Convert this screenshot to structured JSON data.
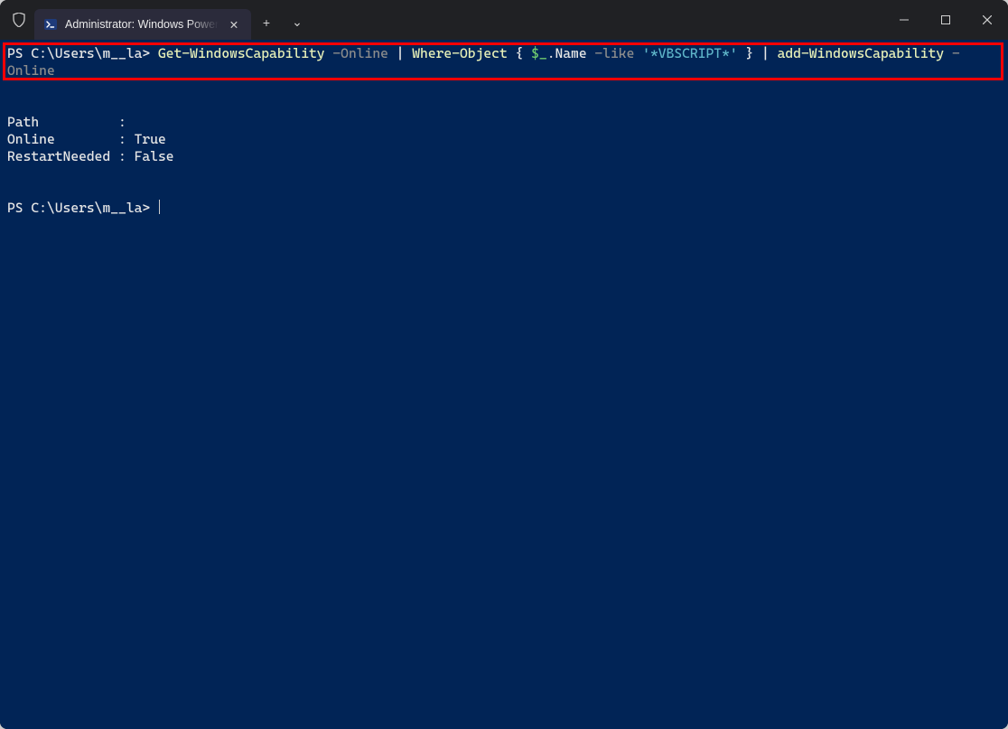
{
  "titlebar": {
    "tab_title": "Administrator: Windows PowerShell",
    "tab_close_glyph": "✕",
    "new_tab_glyph": "+",
    "dropdown_glyph": "⌄",
    "minimize_glyph": "—",
    "maximize_glyph": "▢",
    "close_glyph": "✕"
  },
  "terminal": {
    "prompt1": "PS C:\\Users\\m__la> ",
    "cmd": {
      "get_cap": "Get-WindowsCapability",
      "param_online": " -Online",
      "pipe1": " | ",
      "where": "Where-Object",
      "brace_open": " { ",
      "var": "$_",
      "dot_name": ".Name",
      "like": " -like",
      "space2": " ",
      "str": "'*VBSCRIPT*'",
      "brace_close": " } ",
      "pipe2": "| ",
      "add_cap": "add-WindowsCapability",
      "dash": " -",
      "wrap_online": "Online"
    },
    "output": {
      "path_label": "Path          :",
      "online_label": "Online        : ",
      "online_value": "True",
      "restart_label": "RestartNeeded : ",
      "restart_value": "False"
    },
    "prompt2": "PS C:\\Users\\m__la> "
  }
}
